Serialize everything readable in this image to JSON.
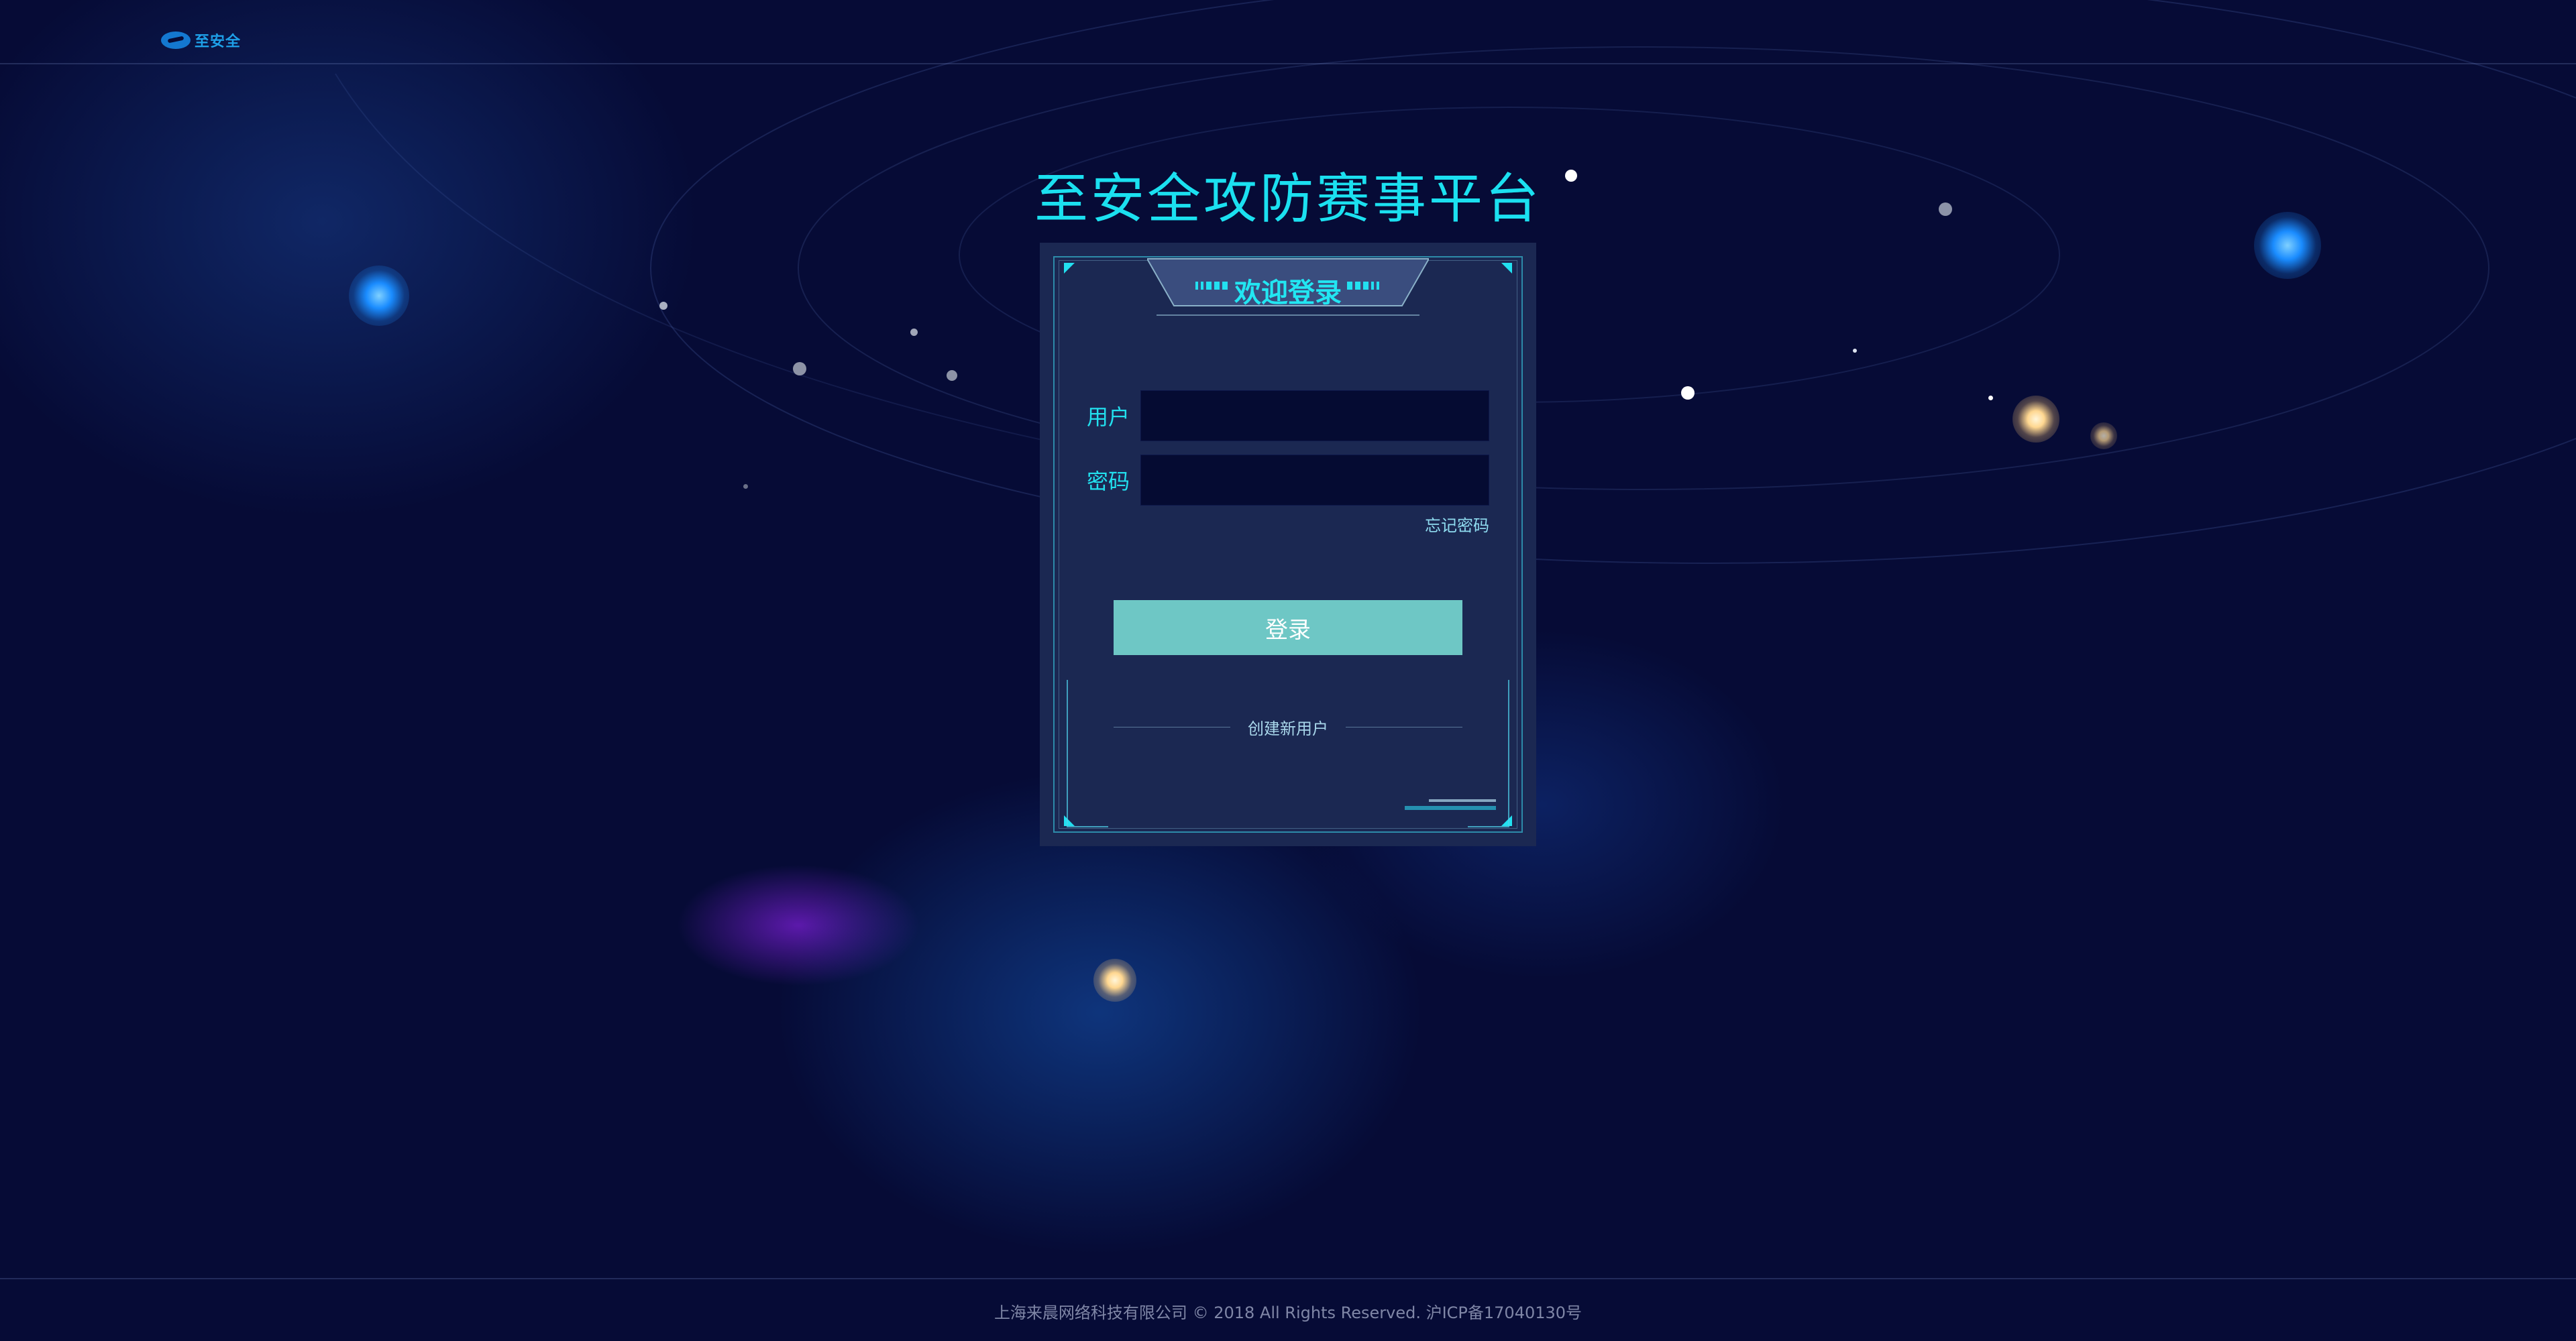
{
  "header": {
    "logo_text": "至安全"
  },
  "title": "至安全攻防赛事平台",
  "login_card": {
    "heading": "欢迎登录",
    "username": {
      "label": "用户",
      "value": "",
      "placeholder": ""
    },
    "password": {
      "label": "密码",
      "value": "",
      "placeholder": ""
    },
    "forgot_password": "忘记密码",
    "login_button": "登录",
    "create_user": "创建新用户"
  },
  "footer": {
    "copyright": "上海来晨网络科技有限公司 © 2018 All Rights Reserved.  沪ICP备17040130号"
  },
  "colors": {
    "background": "#060b36",
    "accent_cyan": "#1be0f0",
    "card": "#1b2852",
    "button": "#6ec7c5"
  }
}
